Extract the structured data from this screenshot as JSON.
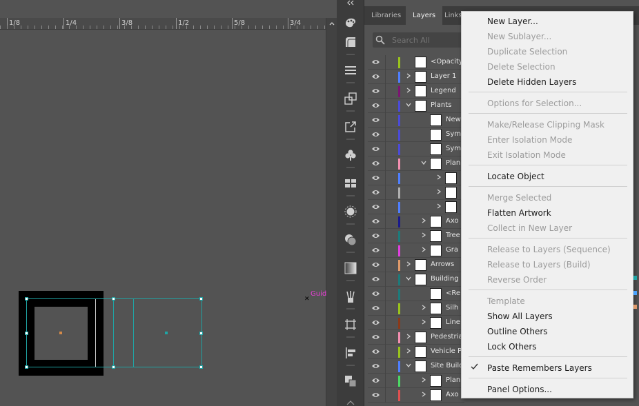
{
  "ruler": {
    "labels": [
      "1/8",
      "1/4",
      "3/8",
      "1/2",
      "5/8",
      "3/4"
    ]
  },
  "canvas": {
    "guide_label": "Guid"
  },
  "panel": {
    "tabs": [
      "Libraries",
      "Layers",
      "Links"
    ],
    "active_tab": "Layers",
    "search_placeholder": "Search All"
  },
  "layers": [
    {
      "name": "<Opacity",
      "color": "#9ac41c"
    },
    {
      "name": "Layer 1",
      "color": "#4f7fff"
    },
    {
      "name": "Legend",
      "color": "#7b1672"
    },
    {
      "name": "Plants",
      "color": "#4b4bd8"
    },
    {
      "name": "New",
      "color": "#4b4bd8"
    },
    {
      "name": "Sym",
      "color": "#4b4bd8"
    },
    {
      "name": "Sym",
      "color": "#4b4bd8"
    },
    {
      "name": "Plan",
      "color": "#f48fb1"
    },
    {
      "name": "",
      "color": "#4f7fff"
    },
    {
      "name": "",
      "color": "#b0b0b0"
    },
    {
      "name": "",
      "color": "#4f7fff"
    },
    {
      "name": "Axo",
      "color": "#1a1a8c"
    },
    {
      "name": "Tree",
      "color": "#1d7b7b"
    },
    {
      "name": "Gra",
      "color": "#e040e0"
    },
    {
      "name": "Arrows",
      "color": "#e09a6a"
    },
    {
      "name": "Building",
      "color": "#1d7b7b"
    },
    {
      "name": "<Re",
      "color": "#1d7b7b"
    },
    {
      "name": "Silh",
      "color": "#9ac41c"
    },
    {
      "name": "Line",
      "color": "#8b3a1a"
    },
    {
      "name": "Pedestria",
      "color": "#f48fb1"
    },
    {
      "name": "Vehicle P",
      "color": "#9ac41c"
    },
    {
      "name": "Site Build",
      "color": "#4f7fff"
    },
    {
      "name": "Plan",
      "color": "#4cd964"
    },
    {
      "name": "Axo",
      "color": "#e05050"
    }
  ],
  "menu": {
    "items": [
      {
        "label": "New Layer...",
        "enabled": true
      },
      {
        "label": "New Sublayer...",
        "enabled": false
      },
      {
        "label": "Duplicate Selection",
        "enabled": false
      },
      {
        "label": "Delete Selection",
        "enabled": false
      },
      {
        "label": "Delete Hidden Layers",
        "enabled": true
      },
      {
        "label": "Options for Selection...",
        "enabled": false
      },
      {
        "label": "Make/Release Clipping Mask",
        "enabled": false
      },
      {
        "label": "Enter Isolation Mode",
        "enabled": false
      },
      {
        "label": "Exit Isolation Mode",
        "enabled": false
      },
      {
        "label": "Locate Object",
        "enabled": true
      },
      {
        "label": "Merge Selected",
        "enabled": false
      },
      {
        "label": "Flatten Artwork",
        "enabled": true
      },
      {
        "label": "Collect in New Layer",
        "enabled": false
      },
      {
        "label": "Release to Layers (Sequence)",
        "enabled": false
      },
      {
        "label": "Release to Layers (Build)",
        "enabled": false
      },
      {
        "label": "Reverse Order",
        "enabled": false
      },
      {
        "label": "Template",
        "enabled": false
      },
      {
        "label": "Show All Layers",
        "enabled": true
      },
      {
        "label": "Outline Others",
        "enabled": true
      },
      {
        "label": "Lock Others",
        "enabled": true
      },
      {
        "label": "Paste Remembers Layers",
        "enabled": true,
        "checked": true
      },
      {
        "label": "Panel Options...",
        "enabled": true
      }
    ]
  }
}
